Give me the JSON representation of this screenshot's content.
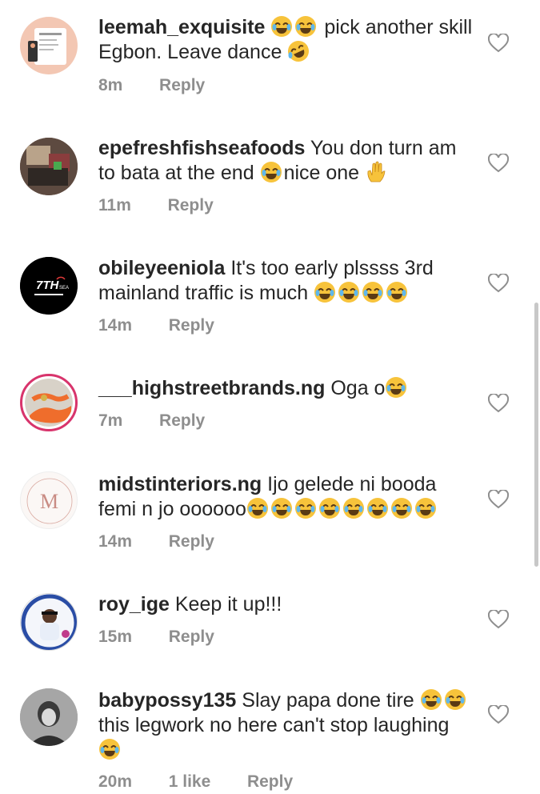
{
  "comments": [
    {
      "username": "leemah_exquisite",
      "pre": " ",
      "emoji_before": 2,
      "text": " pick another skill Egbon. Leave dance ",
      "emoji_after_type": "rofl",
      "emoji_after": 1,
      "time": "8m",
      "likes": "",
      "reply": "Reply"
    },
    {
      "username": "epefreshfishseafoods",
      "pre": " You don turn am to bata at the end ",
      "emoji_before": 0,
      "text": "nice one ",
      "emoji_mid": 1,
      "emoji_after_type": "wave",
      "emoji_after": 1,
      "time": "11m",
      "likes": "",
      "reply": "Reply"
    },
    {
      "username": "obileyeeniola",
      "pre": " It's too early plssss 3rd mainland traffic is much ",
      "emoji_before": 0,
      "text": "",
      "emoji_after_type": "joy",
      "emoji_after": 4,
      "time": "14m",
      "likes": "",
      "reply": "Reply"
    },
    {
      "username": "___highstreetbrands.ng",
      "pre": " Oga o",
      "emoji_before": 0,
      "text": "",
      "emoji_after_type": "joy",
      "emoji_after": 1,
      "time": "7m",
      "likes": "",
      "reply": "Reply"
    },
    {
      "username": "midstinteriors.ng",
      "pre": " Ijo gelede ni booda femi n jo oooooo",
      "emoji_before": 0,
      "text": "",
      "emoji_after_type": "joy",
      "emoji_after": 8,
      "time": "14m",
      "likes": "",
      "reply": "Reply"
    },
    {
      "username": "roy_ige",
      "pre": " Keep it up!!!",
      "emoji_before": 0,
      "text": "",
      "emoji_after_type": "joy",
      "emoji_after": 0,
      "time": "15m",
      "likes": "",
      "reply": "Reply"
    },
    {
      "username": "babypossy135",
      "pre": " Slay papa done tire ",
      "emoji_before": 0,
      "text": "this legwork no here can't stop laughing ",
      "emoji_mid": 2,
      "emoji_after_type": "joy",
      "emoji_after": 1,
      "time": "20m",
      "likes": "1 like",
      "reply": "Reply"
    }
  ],
  "avatar_texts": {
    "obileyeeniola_logo": "7TH",
    "obileyeeniola_sub": "SEA",
    "midst_logo": "M"
  },
  "colors": {
    "text": "#262626",
    "meta": "#8e8e8e",
    "heart": "#8e8e8e"
  }
}
